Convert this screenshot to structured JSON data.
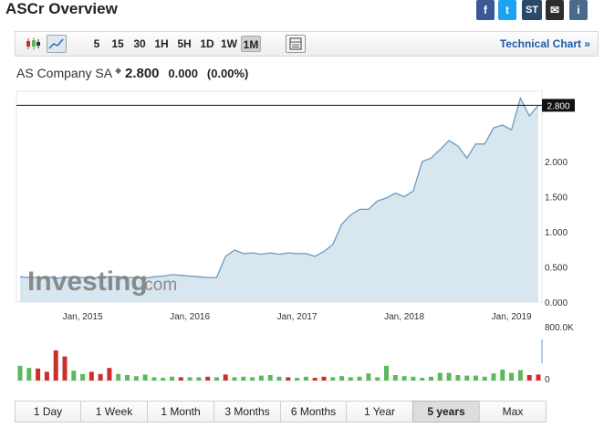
{
  "header": {
    "title": "ASCr Overview"
  },
  "share_icons": [
    {
      "name": "facebook-icon",
      "glyph": "f",
      "color": "#3b5998"
    },
    {
      "name": "twitter-icon",
      "glyph": "t",
      "color": "#1da1f2"
    },
    {
      "name": "stocktwits-icon",
      "glyph": "ST",
      "color": "#2a4a6b"
    },
    {
      "name": "email-icon",
      "glyph": "✉",
      "color": "#2d2d2d"
    },
    {
      "name": "info-icon",
      "glyph": "i",
      "color": "#4a6b8c"
    }
  ],
  "toolbar": {
    "intervals": [
      "5",
      "15",
      "30",
      "1H",
      "5H",
      "1D",
      "1W",
      "1M"
    ],
    "active_interval": "1M",
    "technical_chart_label": "Technical Chart »"
  },
  "quote": {
    "name": "AS Company SA",
    "price": "2.800",
    "change": "0.000",
    "change_pct": "(0.00%)"
  },
  "watermark": {
    "text_main": "Investing",
    "text_suffix": ".com"
  },
  "chart_data": {
    "type": "area",
    "x": [
      "2014-06",
      "2014-07",
      "2014-08",
      "2014-09",
      "2014-10",
      "2014-11",
      "2014-12",
      "2015-01",
      "2015-02",
      "2015-03",
      "2015-04",
      "2015-05",
      "2015-06",
      "2015-07",
      "2015-08",
      "2015-09",
      "2015-10",
      "2015-11",
      "2015-12",
      "2016-01",
      "2016-02",
      "2016-03",
      "2016-04",
      "2016-05",
      "2016-06",
      "2016-07",
      "2016-08",
      "2016-09",
      "2016-10",
      "2016-11",
      "2016-12",
      "2017-01",
      "2017-02",
      "2017-03",
      "2017-04",
      "2017-05",
      "2017-06",
      "2017-07",
      "2017-08",
      "2017-09",
      "2017-10",
      "2017-11",
      "2017-12",
      "2018-01",
      "2018-02",
      "2018-03",
      "2018-04",
      "2018-05",
      "2018-06",
      "2018-07",
      "2018-08",
      "2018-09",
      "2018-10",
      "2018-11",
      "2018-12",
      "2019-01",
      "2019-02",
      "2019-03",
      "2019-04"
    ],
    "values": [
      0.36,
      0.35,
      0.35,
      0.36,
      0.34,
      0.35,
      0.36,
      0.35,
      0.34,
      0.35,
      0.36,
      0.36,
      0.35,
      0.35,
      0.34,
      0.36,
      0.37,
      0.39,
      0.38,
      0.37,
      0.36,
      0.35,
      0.35,
      0.65,
      0.74,
      0.69,
      0.7,
      0.68,
      0.7,
      0.68,
      0.7,
      0.69,
      0.69,
      0.65,
      0.72,
      0.82,
      1.11,
      1.24,
      1.32,
      1.32,
      1.44,
      1.48,
      1.55,
      1.5,
      1.58,
      2.0,
      2.05,
      2.17,
      2.3,
      2.22,
      2.05,
      2.25,
      2.25,
      2.48,
      2.52,
      2.45,
      2.9,
      2.65,
      2.8
    ],
    "volume": [
      0.27,
      0.23,
      0.22,
      0.16,
      0.55,
      0.44,
      0.18,
      0.12,
      0.16,
      0.12,
      0.23,
      0.12,
      0.1,
      0.08,
      0.11,
      0.06,
      0.05,
      0.07,
      0.06,
      0.06,
      0.06,
      0.07,
      0.06,
      0.11,
      0.06,
      0.07,
      0.06,
      0.09,
      0.1,
      0.07,
      0.06,
      0.05,
      0.07,
      0.05,
      0.07,
      0.06,
      0.08,
      0.06,
      0.07,
      0.13,
      0.06,
      0.27,
      0.1,
      0.08,
      0.07,
      0.05,
      0.07,
      0.14,
      0.14,
      0.1,
      0.09,
      0.09,
      0.07,
      0.13,
      0.2,
      0.14,
      0.19,
      0.1,
      0.11
    ],
    "volume_up": [
      true,
      true,
      false,
      false,
      false,
      false,
      true,
      true,
      false,
      false,
      false,
      true,
      true,
      true,
      true,
      true,
      true,
      true,
      false,
      true,
      true,
      false,
      true,
      false,
      true,
      true,
      true,
      true,
      true,
      true,
      false,
      true,
      true,
      false,
      false,
      true,
      true,
      true,
      true,
      true,
      true,
      true,
      true,
      true,
      true,
      true,
      true,
      true,
      true,
      true,
      true,
      true,
      true,
      true,
      true,
      true,
      true,
      false,
      false
    ],
    "y_ticks": [
      "0.000",
      "0.500",
      "1.000",
      "1.500",
      "2.000"
    ],
    "ylim": [
      0,
      3.0
    ],
    "x_tick_labels": [
      "Jan, 2015",
      "Jan, 2016",
      "Jan, 2017",
      "Jan, 2018",
      "Jan, 2019"
    ],
    "x_tick_positions": [
      "2015-01",
      "2016-01",
      "2017-01",
      "2018-01",
      "2019-01"
    ],
    "last_price_label": "2.800",
    "last_price": 2.8,
    "volume_ticks": [
      "800.0K",
      "0"
    ],
    "volume_max": 800000,
    "grid": false,
    "colors": {
      "line": "#6b9ac4",
      "fill": "#d8e6f0",
      "vol_up": "#5cb85c",
      "vol_down": "#c9302c",
      "last_price_bg": "#111111"
    }
  },
  "ranges": {
    "items": [
      "1 Day",
      "1 Week",
      "1 Month",
      "3 Months",
      "6 Months",
      "1 Year",
      "5 years",
      "Max"
    ],
    "active": "5 years"
  }
}
